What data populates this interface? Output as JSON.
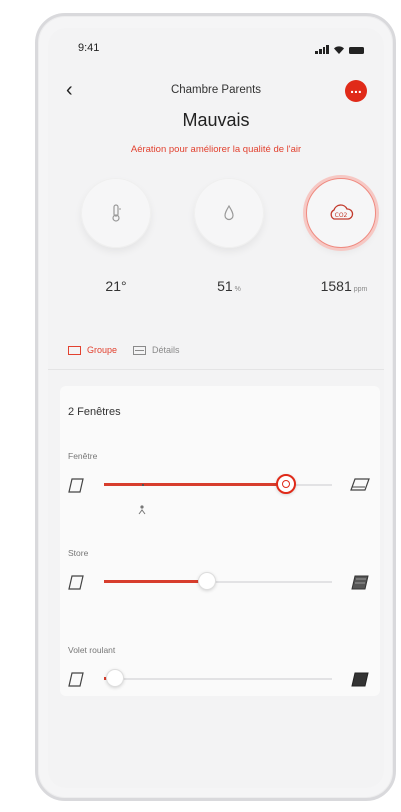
{
  "status_bar": {
    "time": "9:41"
  },
  "header": {
    "title": "Chambre Parents",
    "more_label": "..."
  },
  "summary": {
    "status": "Mauvais",
    "advice": "Aération pour améliorer la qualité de l'air"
  },
  "metrics": [
    {
      "name": "temperature",
      "icon": "thermometer-icon",
      "value": "21°",
      "unit": ""
    },
    {
      "name": "humidity",
      "icon": "droplet-icon",
      "value": "51",
      "unit": "%"
    },
    {
      "name": "co2",
      "icon": "cloud-co2-icon",
      "value": "1581",
      "unit": "ppm"
    }
  ],
  "tabs": [
    {
      "label": "Groupe",
      "active": true
    },
    {
      "label": "Détails",
      "active": false
    }
  ],
  "group": {
    "title": "2 Fenêtres",
    "controls": [
      {
        "label": "Fenêtre",
        "level": 0.8
      },
      {
        "label": "Store",
        "level": 0.45
      },
      {
        "label": "Volet roulant",
        "level": 0.05
      }
    ]
  },
  "colors": {
    "accent": "#e02a19",
    "text": "#333333",
    "muted": "#888888"
  }
}
